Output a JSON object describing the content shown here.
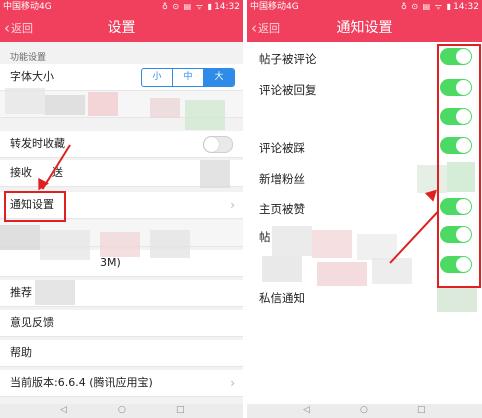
{
  "status": {
    "carrier": "中国移动4G",
    "icons": "♁ ⊙ ▤ ᯤ ▮",
    "time": "14:32"
  },
  "left": {
    "back": "返回",
    "title": "设置",
    "section": "功能设置",
    "font_size_label": "字体大小",
    "font_options": [
      "小",
      "中",
      "大"
    ],
    "rows": {
      "repost": "转发时收藏",
      "receive": "接收",
      "receive_suffix": "送",
      "notify": "通知设置",
      "cache_fragment": "3M)",
      "recommend": "推荐",
      "feedback": "意见反馈",
      "help": "帮助",
      "version": "当前版本:6.6.4 (腾讯应用宝)"
    }
  },
  "right": {
    "back": "返回",
    "title": "通知设置",
    "items": [
      "帖子被评论",
      "评论被回复",
      "",
      "评论被踩",
      "新增粉丝",
      "主页被赞",
      "帖",
      "",
      "私信通知"
    ]
  },
  "nav": {
    "back": "◁",
    "home": "○",
    "recent": "□"
  }
}
